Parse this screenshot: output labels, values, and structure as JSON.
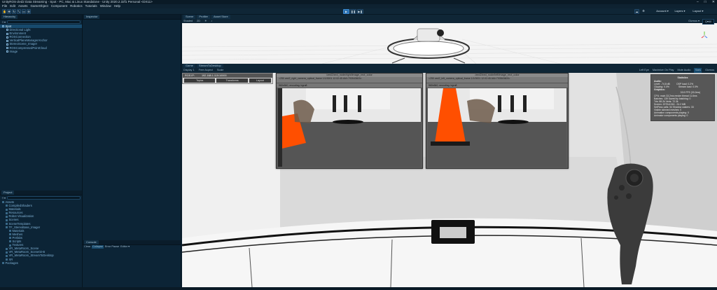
{
  "window": {
    "title": "UnityROS-Zed2 Data Streaming - Spot - PC, Mac & Linux Standalone - Unity 2020.2.32f1 Personal <DX11>",
    "minimize_glyph": "–",
    "maximize_glyph": "□",
    "close_glyph": "✕"
  },
  "menu": [
    "File",
    "Edit",
    "Assets",
    "GameObject",
    "Component",
    "Robotics",
    "Tutorials",
    "Window",
    "Help"
  ],
  "toolbar": {
    "account_label": "Account ▾",
    "layers_label": "Layers ▾",
    "layout_label": "Layout ▾"
  },
  "hierarchy": {
    "tab_label": "Hierarchy",
    "items": [
      {
        "label": "Spot",
        "selected": true
      },
      {
        "label": "Directional Light",
        "selected": false
      },
      {
        "label": "Environment",
        "selected": false
      },
      {
        "label": "ROSConnection",
        "selected": false
      },
      {
        "label": "VerticalPlaneManagerAnchor",
        "selected": false
      },
      {
        "label": "StereoScene_Imager",
        "selected": false
      },
      {
        "label": "ROSCompressedPointCloud",
        "selected": false
      },
      {
        "label": "Image",
        "selected": false
      }
    ]
  },
  "inspector": {
    "tab_label": "Inspector"
  },
  "project": {
    "tab_label": "Project",
    "tree": [
      {
        "label": "Assets",
        "depth": 0
      },
      {
        "label": "CompiledShaders",
        "depth": 1
      },
      {
        "label": "Materials",
        "depth": 1
      },
      {
        "label": "Resources",
        "depth": 1
      },
      {
        "label": "Robot Visualization",
        "depth": 1
      },
      {
        "label": "Scenes",
        "depth": 1
      },
      {
        "label": "SceneTemplates",
        "depth": 1
      },
      {
        "label": "TF_StereoBase_Imager",
        "depth": 1
      },
      {
        "label": "Materials",
        "depth": 2
      },
      {
        "label": "Meshes",
        "depth": 2
      },
      {
        "label": "Prefabs",
        "depth": 2
      },
      {
        "label": "Scripts",
        "depth": 2
      },
      {
        "label": "Textures",
        "depth": 2
      },
      {
        "label": "VR_MetaRoom_Scene",
        "depth": 1
      },
      {
        "label": "VR_MetaRoom_Scene02-B",
        "depth": 1
      },
      {
        "label": "VR_MetaRoom_StreamToDesktop",
        "depth": 1
      },
      {
        "label": "XR",
        "depth": 1
      },
      {
        "label": "Packages",
        "depth": 0
      }
    ]
  },
  "console": {
    "tab_label": "Console",
    "buttons": [
      "Clear",
      "Collapse",
      "Error Pause",
      "Editor ▾"
    ]
  },
  "scene_tabs": [
    "Scene",
    "Profiler",
    "Asset Store"
  ],
  "scene_toolbar": {
    "shading": "Shaded",
    "mode_2d": "2D",
    "gizmos": "Gizmos ▾",
    "search": "Q▾All"
  },
  "game": {
    "tabs": [
      "Game",
      "StreamToDesktop"
    ],
    "display": "Display 1",
    "aspect": "Free Aspect",
    "scale_label": "Scale",
    "right_options": [
      "Left Eye",
      "Maximize On Play",
      "Mute Audio",
      "Stats",
      "Gizmos"
    ]
  },
  "ros_panel": {
    "label": "ROS IP:",
    "value": "192.168.1.115:10000",
    "buttons": [
      "Topics",
      "Transforms",
      "Layout"
    ]
  },
  "cam_right": {
    "topic": "/zed2/zed_node/right/image_rect_color",
    "header": "<250 zed2_right_camera_optical_frame 1/1/0001 12:02:45 AM>793543603>",
    "encoding": "960x540, encoding: bgra8"
  },
  "cam_left": {
    "topic": "/zed2/zed_node/left/image_rect_color",
    "header": "<250 zed2_left_camera_optical_frame 1/1/0001 12:02:45 AM>793543603>",
    "encoding": "960x540, encoding: bgra8"
  },
  "stats": {
    "title": "Statistics",
    "audio_heading": "Audio:",
    "audio_lines": [
      "Level: -74.8 dB          DSP load: 0.2%",
      "Clipping: 0.0%              Stream load: 0.0%"
    ],
    "graphics_heading": "Graphics:",
    "graphics_lines": [
      "                                        33.9 FPS (33.2ms)",
      "CPU: main 33.2ms  render thread 11.6ms",
      "Batches: 139     Saved by batching: 0",
      "Tris: 88.2k      Verts: 72.3k",
      "Screen: 2070x1016 - 24.2 MB",
      "SetPass calls: 54     Shadow casters: 33",
      "Visible skinned meshes: 0",
      "Animation components playing: 0",
      "Animator components playing: 0"
    ]
  },
  "colors": {
    "editor_bg": "#0c2436",
    "accent": "#174a6d",
    "cone": "#ff4f00"
  }
}
